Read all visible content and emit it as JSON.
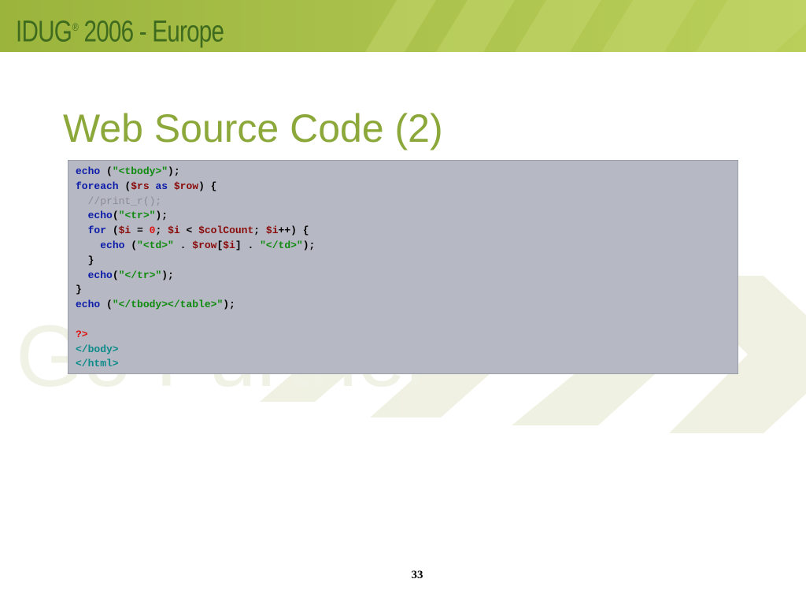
{
  "header": {
    "logo_text": "IDUG",
    "logo_reg": "®",
    "logo_year": " 2006 - Europe"
  },
  "watermark_text": "Go Further",
  "slide": {
    "title": "Web Source Code (2)",
    "page_number": "33"
  },
  "code_lines": [
    [
      {
        "t": "echo",
        "c": "kw"
      },
      {
        "t": " (",
        "c": ""
      },
      {
        "t": "\"<tbody>\"",
        "c": "str"
      },
      {
        "t": ");",
        "c": ""
      }
    ],
    [
      {
        "t": "foreach",
        "c": "kw"
      },
      {
        "t": " (",
        "c": ""
      },
      {
        "t": "$rs",
        "c": "var"
      },
      {
        "t": " ",
        "c": ""
      },
      {
        "t": "as",
        "c": "kw"
      },
      {
        "t": " ",
        "c": ""
      },
      {
        "t": "$row",
        "c": "var"
      },
      {
        "t": ") {",
        "c": ""
      }
    ],
    [
      {
        "t": "  ",
        "c": ""
      },
      {
        "t": "//print_r();",
        "c": "cmt"
      }
    ],
    [
      {
        "t": "  ",
        "c": ""
      },
      {
        "t": "echo",
        "c": "kw"
      },
      {
        "t": "(",
        "c": ""
      },
      {
        "t": "\"<tr>\"",
        "c": "str"
      },
      {
        "t": ");",
        "c": ""
      }
    ],
    [
      {
        "t": "  ",
        "c": ""
      },
      {
        "t": "for",
        "c": "kw"
      },
      {
        "t": " (",
        "c": ""
      },
      {
        "t": "$i",
        "c": "var"
      },
      {
        "t": " = ",
        "c": ""
      },
      {
        "t": "0",
        "c": "num"
      },
      {
        "t": "; ",
        "c": ""
      },
      {
        "t": "$i",
        "c": "var"
      },
      {
        "t": " < ",
        "c": ""
      },
      {
        "t": "$colCount",
        "c": "var"
      },
      {
        "t": "; ",
        "c": ""
      },
      {
        "t": "$i",
        "c": "var"
      },
      {
        "t": "++) {",
        "c": ""
      }
    ],
    [
      {
        "t": "    ",
        "c": ""
      },
      {
        "t": "echo",
        "c": "kw"
      },
      {
        "t": " (",
        "c": ""
      },
      {
        "t": "\"<td>\"",
        "c": "str"
      },
      {
        "t": " . ",
        "c": ""
      },
      {
        "t": "$row",
        "c": "var"
      },
      {
        "t": "[",
        "c": ""
      },
      {
        "t": "$i",
        "c": "var"
      },
      {
        "t": "] . ",
        "c": ""
      },
      {
        "t": "\"</td>\"",
        "c": "str"
      },
      {
        "t": ");",
        "c": ""
      }
    ],
    [
      {
        "t": "  }",
        "c": ""
      }
    ],
    [
      {
        "t": "  ",
        "c": ""
      },
      {
        "t": "echo",
        "c": "kw"
      },
      {
        "t": "(",
        "c": ""
      },
      {
        "t": "\"</tr>\"",
        "c": "str"
      },
      {
        "t": ");",
        "c": ""
      }
    ],
    [
      {
        "t": "}",
        "c": ""
      }
    ],
    [
      {
        "t": "echo",
        "c": "kw"
      },
      {
        "t": " (",
        "c": ""
      },
      {
        "t": "\"</tbody></table>\"",
        "c": "str"
      },
      {
        "t": ");",
        "c": ""
      }
    ],
    [
      {
        "t": "",
        "c": ""
      }
    ],
    [
      {
        "t": "?>",
        "c": "php"
      }
    ],
    [
      {
        "t": "</body>",
        "c": "tag"
      }
    ],
    [
      {
        "t": "</html>",
        "c": "tag"
      }
    ]
  ]
}
